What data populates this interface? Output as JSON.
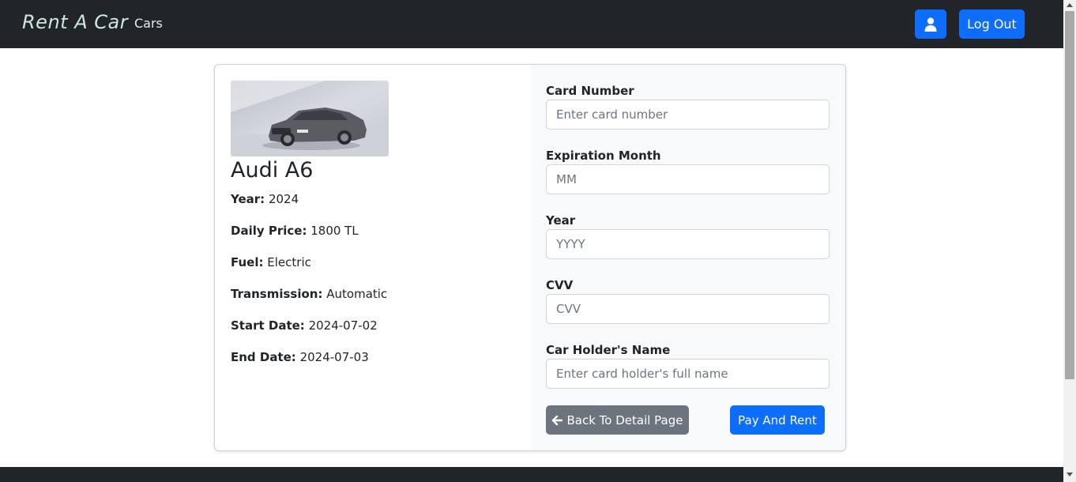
{
  "navbar": {
    "brand": "Rent A Car",
    "cars_link": "Cars",
    "user_icon": "user-icon",
    "logout_label": "Log Out",
    "bg_color": "#212529",
    "accent_color": "#0d6efd"
  },
  "car": {
    "title": "Audi A6",
    "image_icon": "car-photo",
    "specs": [
      {
        "label": "Year:",
        "value": "2024"
      },
      {
        "label": "Daily Price:",
        "value": "1800 TL"
      },
      {
        "label": "Fuel:",
        "value": "Electric"
      },
      {
        "label": "Transmission:",
        "value": "Automatic"
      },
      {
        "label": "Start Date:",
        "value": "2024-07-02"
      },
      {
        "label": "End Date:",
        "value": "2024-07-03"
      }
    ]
  },
  "payment": {
    "card_number": {
      "label": "Card Number",
      "placeholder": "Enter card number",
      "value": ""
    },
    "exp_month": {
      "label": "Expiration Month",
      "placeholder": "MM",
      "value": ""
    },
    "exp_year": {
      "label": "Year",
      "placeholder": "YYYY",
      "value": ""
    },
    "cvv": {
      "label": "CVV",
      "placeholder": "CVV",
      "value": ""
    },
    "holder_name": {
      "label": "Car Holder's Name",
      "placeholder": "Enter card holder's full name",
      "value": ""
    },
    "back_label": "Back To Detail Page",
    "back_icon": "arrow-left-icon",
    "pay_label": "Pay And Rent",
    "secondary_color": "#6c757d"
  }
}
